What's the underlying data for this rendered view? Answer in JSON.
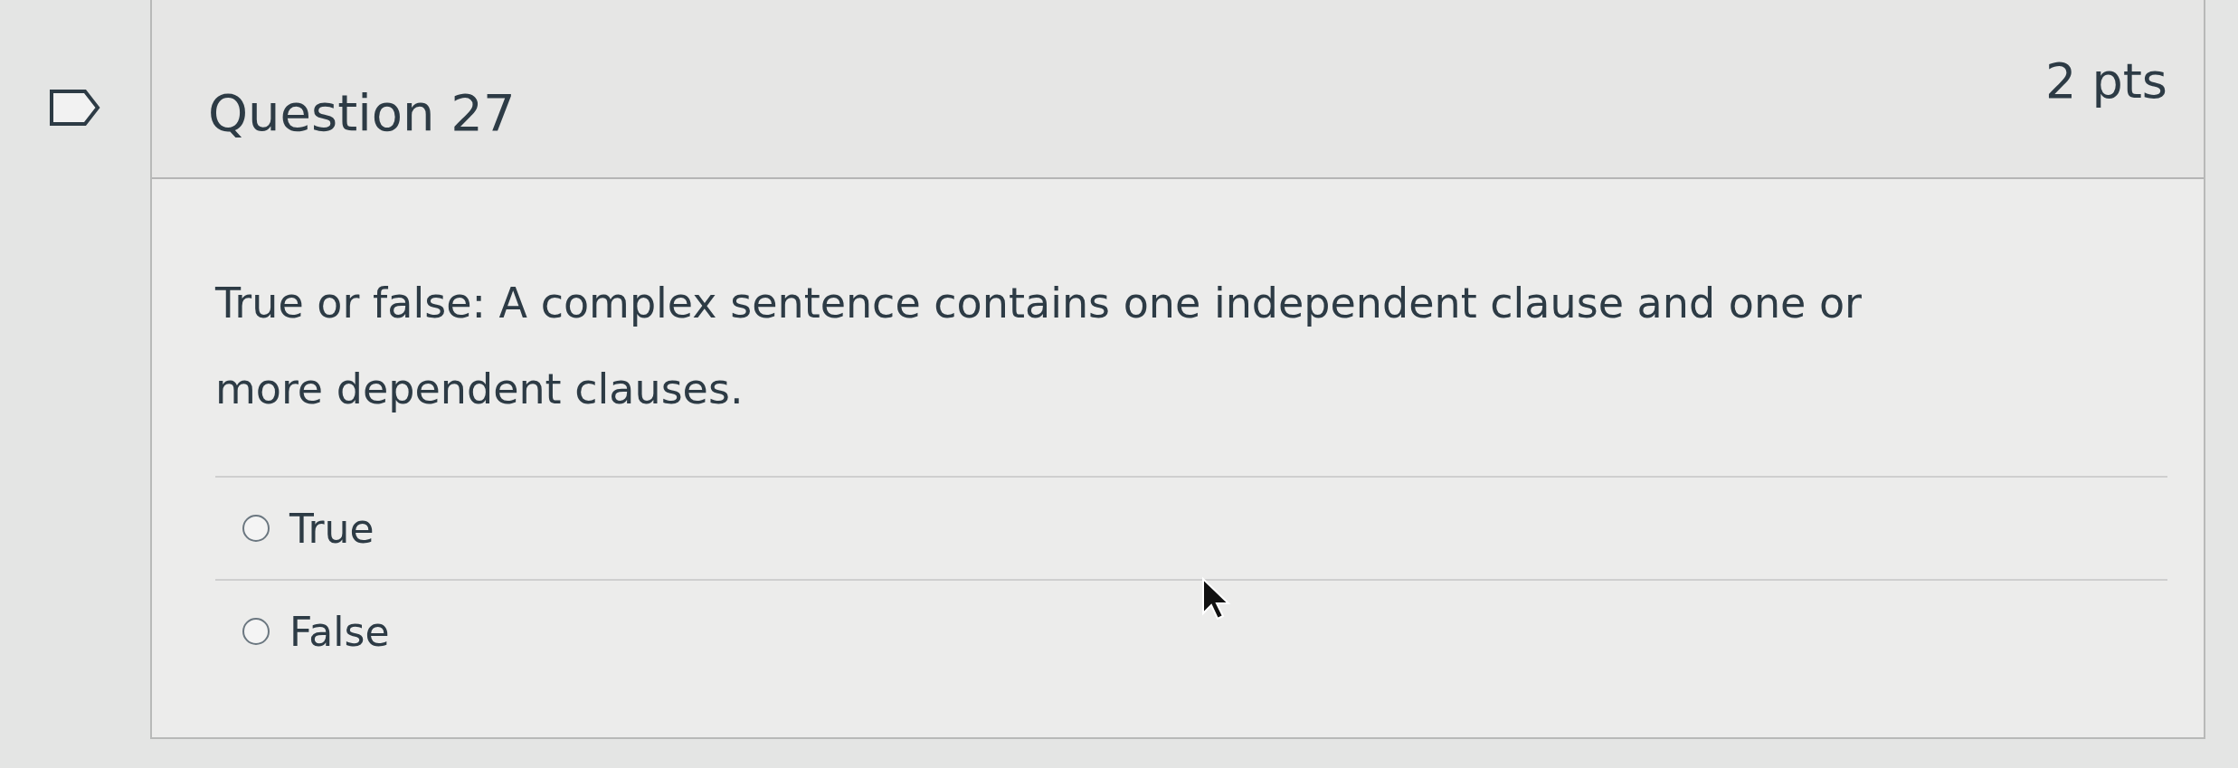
{
  "question": {
    "title": "Question 27",
    "points": "2 pts",
    "flagged": false,
    "text": "True or false: A complex sentence contains one independent clause and one or more dependent clauses.",
    "answers": [
      {
        "label": "True",
        "selected": false
      },
      {
        "label": "False",
        "selected": false
      }
    ]
  }
}
